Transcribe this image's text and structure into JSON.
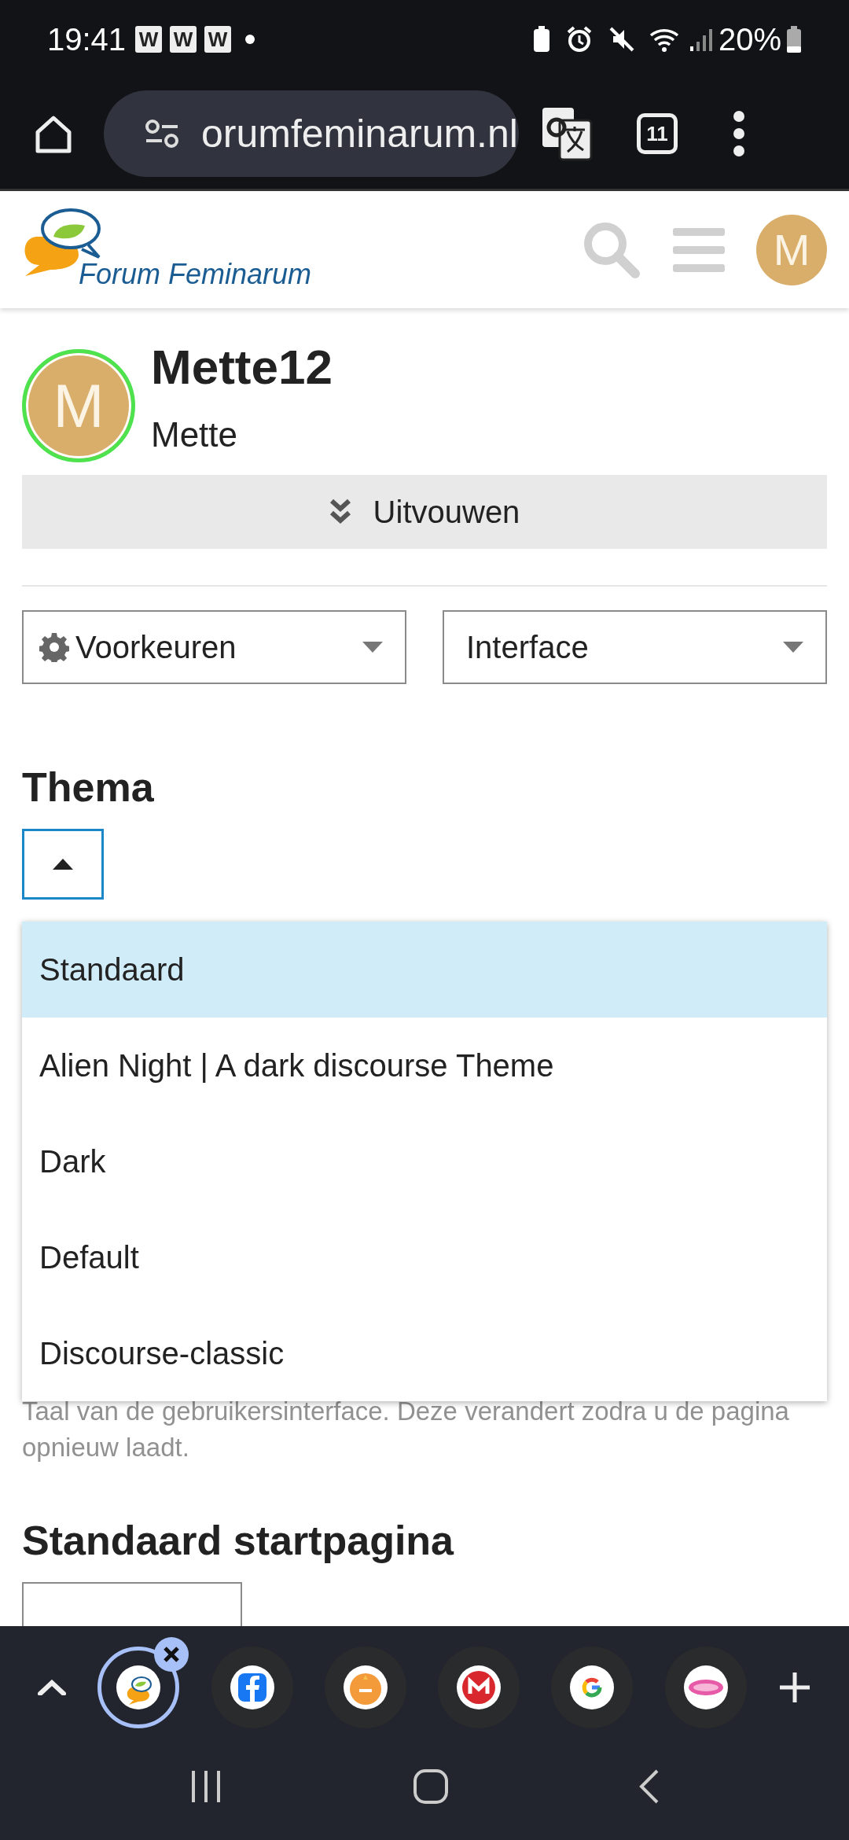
{
  "status_bar": {
    "time": "19:41",
    "notifications": [
      "W",
      "W",
      "W"
    ],
    "battery": "20%"
  },
  "browser": {
    "url": "orumfeminarum.nl",
    "tab_count": "11"
  },
  "site_header": {
    "logo_text": "Forum Feminarum",
    "avatar_letter": "M"
  },
  "profile": {
    "avatar_letter": "M",
    "online": true,
    "username": "Mette12",
    "name": "Mette",
    "expand_button": "Uitvouwen"
  },
  "nav_dropdowns": [
    {
      "label": "Voorkeuren",
      "kind": "gear"
    },
    {
      "label": "Interface",
      "kind": "plain"
    }
  ],
  "theme": {
    "heading": "Thema",
    "expanded": true,
    "options": [
      {
        "label": "Standaard",
        "selected": true
      },
      {
        "label": "Alien Night | A dark discourse Theme",
        "selected": false
      },
      {
        "label": "Dark",
        "selected": false
      },
      {
        "label": "Default",
        "selected": false
      },
      {
        "label": "Discourse-classic",
        "selected": false
      }
    ]
  },
  "language_help": "Taal van de gebruikersinterface. Deze verandert zodra u de pagina opnieuw laadt.",
  "homepage": {
    "heading": "Standaard startpagina"
  },
  "tab_strip": [
    {
      "kind": "forum",
      "selected": true
    },
    {
      "kind": "facebook",
      "selected": false
    },
    {
      "kind": "postnl",
      "selected": false
    },
    {
      "kind": "mega",
      "selected": false
    },
    {
      "kind": "google",
      "selected": false
    },
    {
      "kind": "candy",
      "selected": false
    }
  ]
}
